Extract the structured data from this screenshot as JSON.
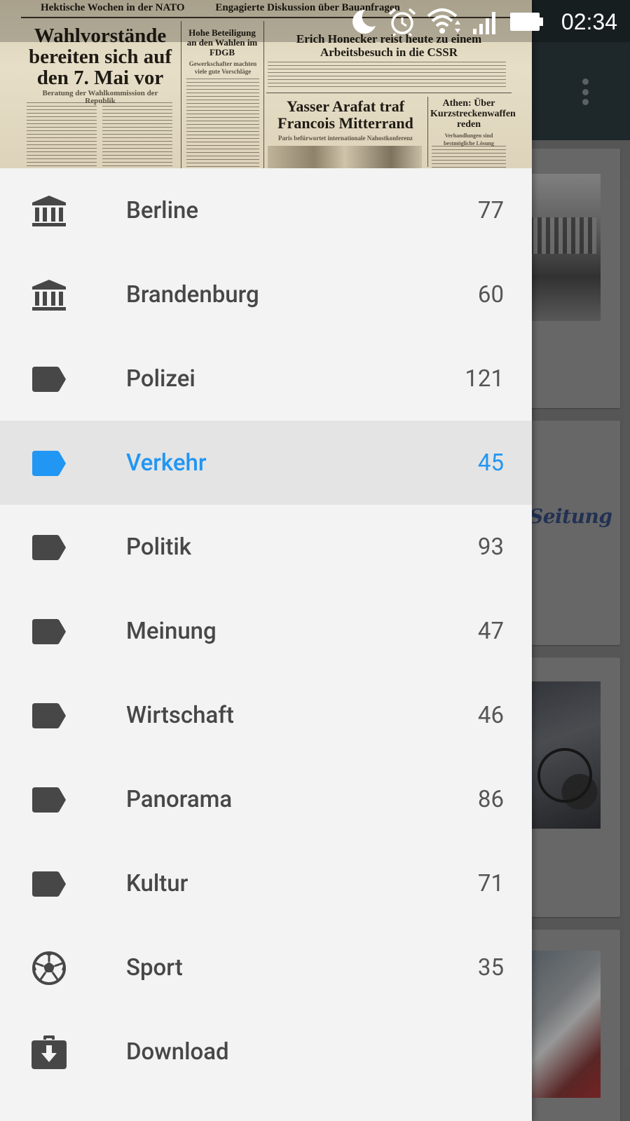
{
  "status_bar": {
    "time": "02:34",
    "icons": [
      "moon-icon",
      "alarm-icon",
      "wifi-icon",
      "signal-icon",
      "battery-icon"
    ]
  },
  "header_image": {
    "topbar_left": "Hektische Wochen in der NATO",
    "topbar_right": "Engagierte Diskussion über Bauanfragen",
    "headline_lead": "Wahlvorstände bereiten sich auf den 7. Mai vor",
    "headline_lead_sub": "Beratung der Wahlkommission der Republik",
    "col2_head": "Hohe Beteiligung an den Wahlen im FDGB",
    "col2_sub": "Gewerkschafter machten viele gute Vorschläge",
    "right_head": "Erich Honecker reist heute zu einem Arbeitsbesuch in die CSSR",
    "mid_head": "Yasser Arafat traf Francois Mitterrand",
    "mid_sub": "Paris befürwortet internationale Nahostkonferenz",
    "side_head": "Athen: Über Kurzstreckenwaffen reden",
    "side_sub": "Verhandlungen sind bestmögliche Lösung"
  },
  "menu": {
    "items": [
      {
        "label": "Berline",
        "count": "77",
        "icon": "bank-icon"
      },
      {
        "label": "Brandenburg",
        "count": "60",
        "icon": "bank-icon"
      },
      {
        "label": "Polizei",
        "count": "121",
        "icon": "label-icon"
      },
      {
        "label": "Verkehr",
        "count": "45",
        "icon": "label-icon",
        "selected": true
      },
      {
        "label": "Politik",
        "count": "93",
        "icon": "label-icon"
      },
      {
        "label": "Meinung",
        "count": "47",
        "icon": "label-icon"
      },
      {
        "label": "Wirtschaft",
        "count": "46",
        "icon": "label-icon"
      },
      {
        "label": "Panorama",
        "count": "86",
        "icon": "label-icon"
      },
      {
        "label": "Kultur",
        "count": "71",
        "icon": "label-icon"
      },
      {
        "label": "Sport",
        "count": "35",
        "icon": "soccer-ball-icon"
      },
      {
        "label": "Download",
        "count": "",
        "icon": "download-briefcase-icon"
      }
    ]
  },
  "background": {
    "partial_text": "Seitung"
  },
  "colors": {
    "accent": "#2196f3",
    "icon_default": "#474747",
    "drawer_bg": "#f3f3f3",
    "selected_bg": "#e4e4e4",
    "app_bar": "#253033"
  }
}
